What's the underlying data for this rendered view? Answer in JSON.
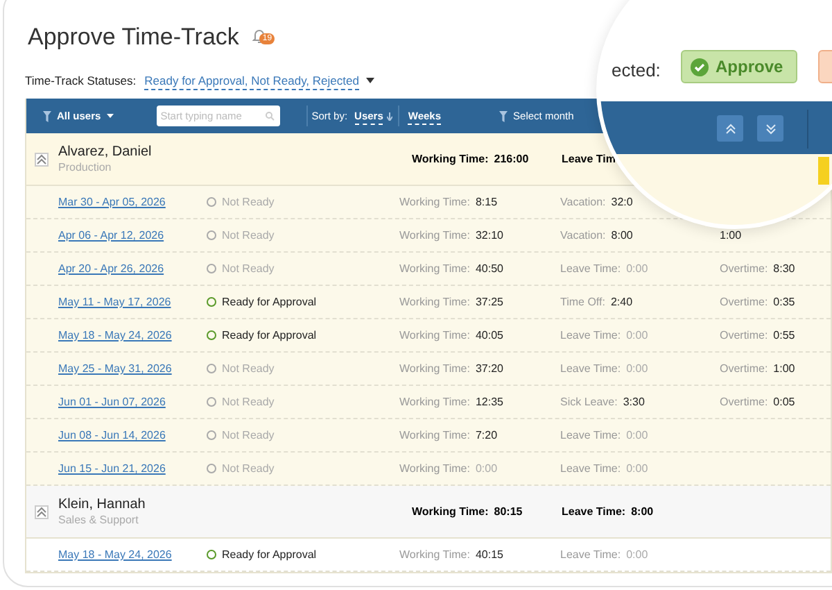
{
  "title": "Approve Time-Track",
  "notification_count": "19",
  "status_filter": {
    "label": "Time-Track Statuses:",
    "value": "Ready for Approval, Not Ready, Rejected"
  },
  "toolbar": {
    "users_filter": "All users",
    "search_placeholder": "Start typing name",
    "sort_label": "Sort by:",
    "sort_value": "Users",
    "period": "Weeks",
    "month_filter": "Select month"
  },
  "magnifier": {
    "label": "ected:",
    "approve_button": "Approve"
  },
  "groups": [
    {
      "name": "Alvarez, Daniel",
      "department": "Production",
      "expanded": true,
      "selected": true,
      "working_label": "Working Time:",
      "working_value": "216:00",
      "leave_label": "Leave Tim",
      "weeks": [
        {
          "period": "Mar 30 - Apr 05, 2026",
          "status": {
            "kind": "not_ready",
            "label": "Not Ready"
          },
          "working": {
            "label": "Working Time:",
            "value": "8:15",
            "dim": false
          },
          "leave": {
            "label": "Vacation:",
            "value": "32:0",
            "dim": false
          }
        },
        {
          "period": "Apr 06 - Apr 12, 2026",
          "status": {
            "kind": "not_ready",
            "label": "Not Ready"
          },
          "working": {
            "label": "Working Time:",
            "value": "32:10",
            "dim": false
          },
          "leave": {
            "label": "Vacation:",
            "value": "8:00",
            "dim": false
          },
          "overtime": {
            "value": "1:00"
          }
        },
        {
          "period": "Apr 20 - Apr 26, 2026",
          "status": {
            "kind": "not_ready",
            "label": "Not Ready"
          },
          "working": {
            "label": "Working Time:",
            "value": "40:50",
            "dim": false
          },
          "leave": {
            "label": "Leave Time:",
            "value": "0:00",
            "dim": true
          },
          "overtime": {
            "label": "Overtime:",
            "value": "8:30"
          }
        },
        {
          "period": "May 11 - May 17, 2026",
          "status": {
            "kind": "ready",
            "label": "Ready for Approval"
          },
          "working": {
            "label": "Working Time:",
            "value": "37:25",
            "dim": false
          },
          "leave": {
            "label": "Time Off:",
            "value": "2:40",
            "dim": false
          },
          "overtime": {
            "label": "Overtime:",
            "value": "0:35"
          }
        },
        {
          "period": "May 18 - May 24, 2026",
          "status": {
            "kind": "ready",
            "label": "Ready for Approval"
          },
          "working": {
            "label": "Working Time:",
            "value": "40:05",
            "dim": false
          },
          "leave": {
            "label": "Leave Time:",
            "value": "0:00",
            "dim": true
          },
          "overtime": {
            "label": "Overtime:",
            "value": "0:55"
          }
        },
        {
          "period": "May 25 - May 31, 2026",
          "status": {
            "kind": "not_ready",
            "label": "Not Ready"
          },
          "working": {
            "label": "Working Time:",
            "value": "37:20",
            "dim": false
          },
          "leave": {
            "label": "Leave Time:",
            "value": "0:00",
            "dim": true
          },
          "overtime": {
            "label": "Overtime:",
            "value": "1:00"
          }
        },
        {
          "period": "Jun 01 - Jun 07, 2026",
          "status": {
            "kind": "not_ready",
            "label": "Not Ready"
          },
          "working": {
            "label": "Working Time:",
            "value": "12:35",
            "dim": false
          },
          "leave": {
            "label": "Sick Leave:",
            "value": "3:30",
            "dim": false
          },
          "overtime": {
            "label": "Overtime:",
            "value": "0:05"
          }
        },
        {
          "period": "Jun 08 - Jun 14, 2026",
          "status": {
            "kind": "not_ready",
            "label": "Not Ready"
          },
          "working": {
            "label": "Working Time:",
            "value": "7:20",
            "dim": false
          },
          "leave": {
            "label": "Leave Time:",
            "value": "0:00",
            "dim": true
          }
        },
        {
          "period": "Jun 15 - Jun 21, 2026",
          "status": {
            "kind": "not_ready",
            "label": "Not Ready"
          },
          "working": {
            "label": "Working Time:",
            "value": "0:00",
            "dim": true
          },
          "leave": {
            "label": "Leave Time:",
            "value": "0:00",
            "dim": true
          }
        }
      ]
    },
    {
      "name": "Klein, Hannah",
      "department": "Sales & Support",
      "expanded": true,
      "selected": false,
      "working_label": "Working Time:",
      "working_value": "80:15",
      "leave_label": "Leave Time:",
      "leave_value": "8:00",
      "weeks": [
        {
          "period": "May 18 - May 24, 2026",
          "status": {
            "kind": "ready",
            "label": "Ready for Approval"
          },
          "working": {
            "label": "Working Time:",
            "value": "40:15",
            "dim": false
          },
          "leave": {
            "label": "Leave Time:",
            "value": "0:00",
            "dim": true
          }
        }
      ]
    }
  ]
}
